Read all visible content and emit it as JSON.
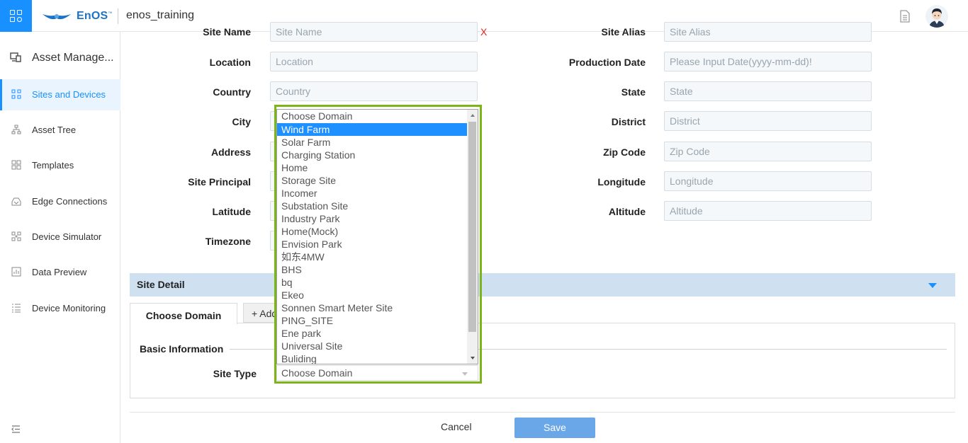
{
  "header": {
    "logo_text": "EnOS",
    "logo_tm": "™",
    "org_name": "enos_training"
  },
  "sidebar": {
    "title": "Asset Manage...",
    "items": [
      {
        "label": "Sites and Devices",
        "active": true
      },
      {
        "label": "Asset Tree"
      },
      {
        "label": "Templates"
      },
      {
        "label": "Edge Connections"
      },
      {
        "label": "Device Simulator"
      },
      {
        "label": "Data Preview"
      },
      {
        "label": "Device Monitoring"
      }
    ]
  },
  "form": {
    "site_name_label": "Site Name",
    "site_name_placeholder": "Site Name",
    "site_alias_label": "Site Alias",
    "site_alias_placeholder": "Site Alias",
    "location_label": "Location",
    "location_placeholder": "Location",
    "production_date_label": "Production Date",
    "production_date_placeholder": "Please Input Date(yyyy-mm-dd)!",
    "country_label": "Country",
    "country_placeholder": "Country",
    "state_label": "State",
    "state_placeholder": "State",
    "city_label": "City",
    "district_label": "District",
    "district_placeholder": "District",
    "address_label": "Address",
    "zip_label": "Zip Code",
    "zip_placeholder": "Zip Code",
    "principal_label": "Site Principal",
    "longitude_label": "Longitude",
    "longitude_placeholder": "Longitude",
    "latitude_label": "Latitude",
    "altitude_label": "Altitude",
    "altitude_placeholder": "Altitude",
    "timezone_label": "Timezone",
    "required_mark": "X"
  },
  "site_detail": {
    "title": "Site Detail",
    "tab_active": "Choose Domain",
    "tab_add": "+ Add",
    "basic_info": "Basic Information",
    "site_type_label": "Site Type",
    "site_type_value": "Choose Domain"
  },
  "dropdown": {
    "options": [
      "Choose Domain",
      "Wind Farm",
      "Solar Farm",
      "Charging Station",
      "Home",
      "Storage Site",
      "Incomer",
      "Substation Site",
      "Industry Park",
      "Home(Mock)",
      "Envision Park",
      "如东4MW",
      "BHS",
      "bq",
      "Ekeo",
      "Sonnen Smart Meter Site",
      "PING_SITE",
      "Ene park",
      "Universal Site",
      "Buliding"
    ],
    "selected_index": 1
  },
  "footer": {
    "cancel": "Cancel",
    "save": "Save"
  },
  "colors": {
    "accent": "#1890ff",
    "highlight_frame": "#7cb517",
    "save_button": "#6aa7e8",
    "detail_bar": "#cfe0f0"
  }
}
